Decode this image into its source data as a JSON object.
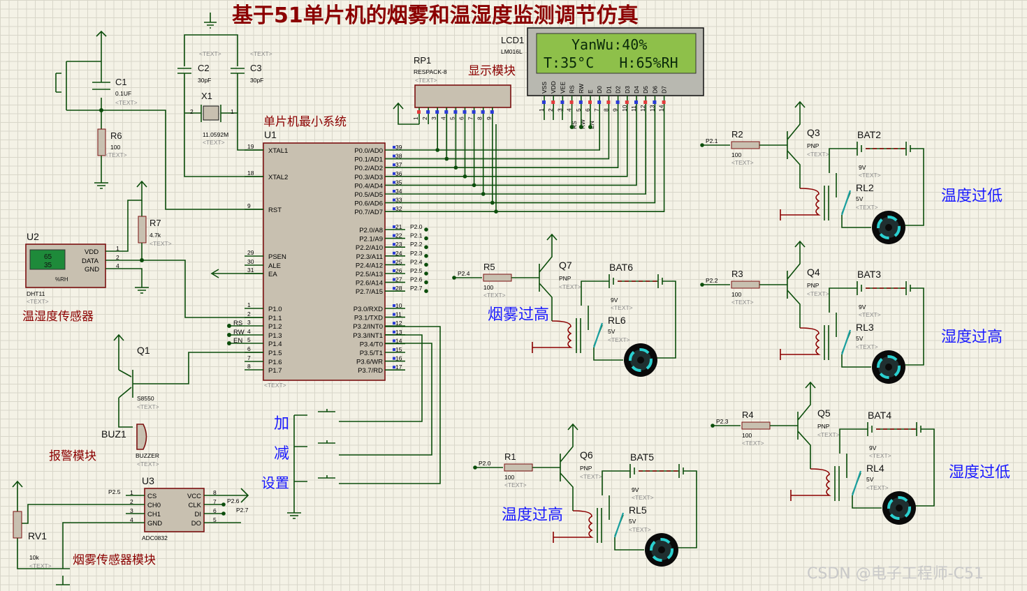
{
  "title": "基于51单片机的烟雾和温湿度监测调节仿真",
  "watermark": "CSDN @电子工程师-C51",
  "module_labels": {
    "mcu": "单片机最小系统",
    "display": "显示模块",
    "dht": "温湿度传感器",
    "alarm": "报警模块",
    "smoke_sensor": "烟雾传感器模块"
  },
  "buttons": {
    "plus": "加",
    "minus": "减",
    "set": "设置"
  },
  "actuator_labels": {
    "q3": "温度过低",
    "q4": "湿度过高",
    "q5": "湿度过低",
    "q7": "烟雾过高",
    "q6": "温度过高"
  },
  "text_placeholder": "<TEXT>",
  "lcd": {
    "ref": "LCD1",
    "model": "LM016L",
    "line1": "YanWu:40%",
    "line2": "T:35°C   H:65%RH",
    "pins": [
      "VSS",
      "VDD",
      "VEE",
      "RS",
      "RW",
      "E",
      "D0",
      "D1",
      "D2",
      "D3",
      "D4",
      "D5",
      "D6",
      "D7"
    ],
    "pin_numbers": [
      "1",
      "2",
      "3",
      "4",
      "5",
      "6",
      "7",
      "8",
      "9",
      "10",
      "11",
      "12",
      "13",
      "14"
    ],
    "net_labels": [
      "RS",
      "RW",
      "EN"
    ]
  },
  "rp1": {
    "ref": "RP1",
    "model": "RESPACK-8",
    "pins": [
      "1",
      "2",
      "3",
      "4",
      "5",
      "6",
      "7",
      "8",
      "9"
    ]
  },
  "u1": {
    "ref": "U1",
    "left_pins": [
      {
        "num": "19",
        "name": "XTAL1"
      },
      {
        "num": "18",
        "name": "XTAL2"
      },
      {
        "num": "9",
        "name": "RST"
      },
      {
        "num": "29",
        "name": "PSEN"
      },
      {
        "num": "30",
        "name": "ALE"
      },
      {
        "num": "31",
        "name": "EA"
      },
      {
        "num": "1",
        "name": "P1.0"
      },
      {
        "num": "2",
        "name": "P1.1"
      },
      {
        "num": "3",
        "name": "P1.2"
      },
      {
        "num": "4",
        "name": "P1.3"
      },
      {
        "num": "5",
        "name": "P1.4"
      },
      {
        "num": "6",
        "name": "P1.5"
      },
      {
        "num": "7",
        "name": "P1.6"
      },
      {
        "num": "8",
        "name": "P1.7"
      }
    ],
    "right_pins": [
      {
        "num": "39",
        "name": "P0.0/AD0"
      },
      {
        "num": "38",
        "name": "P0.1/AD1"
      },
      {
        "num": "37",
        "name": "P0.2/AD2"
      },
      {
        "num": "36",
        "name": "P0.3/AD3"
      },
      {
        "num": "35",
        "name": "P0.4/AD4"
      },
      {
        "num": "34",
        "name": "P0.5/AD5"
      },
      {
        "num": "33",
        "name": "P0.6/AD6"
      },
      {
        "num": "32",
        "name": "P0.7/AD7"
      },
      {
        "num": "21",
        "name": "P2.0/A8"
      },
      {
        "num": "22",
        "name": "P2.1/A9"
      },
      {
        "num": "23",
        "name": "P2.2/A10"
      },
      {
        "num": "24",
        "name": "P2.3/A11"
      },
      {
        "num": "25",
        "name": "P2.4/A12"
      },
      {
        "num": "26",
        "name": "P2.5/A13"
      },
      {
        "num": "27",
        "name": "P2.6/A14"
      },
      {
        "num": "28",
        "name": "P2.7/A15"
      },
      {
        "num": "10",
        "name": "P3.0/RXD"
      },
      {
        "num": "11",
        "name": "P3.1/TXD"
      },
      {
        "num": "12",
        "name": "P3.2/INT0"
      },
      {
        "num": "13",
        "name": "P3.3/INT1"
      },
      {
        "num": "14",
        "name": "P3.4/T0"
      },
      {
        "num": "15",
        "name": "P3.5/T1"
      },
      {
        "num": "16",
        "name": "P3.6/WR"
      },
      {
        "num": "17",
        "name": "P3.7/RD"
      }
    ],
    "p2_nets": [
      "P2.0",
      "P2.1",
      "P2.2",
      "P2.3",
      "P2.4",
      "P2.5",
      "P2.6",
      "P2.7"
    ],
    "p1_nets": [
      "RS",
      "RW",
      "EN"
    ]
  },
  "parts": {
    "c1": {
      "ref": "C1",
      "value": "0.1UF"
    },
    "c2": {
      "ref": "C2",
      "value": "30pF"
    },
    "c3": {
      "ref": "C3",
      "value": "30pF"
    },
    "x1": {
      "ref": "X1",
      "value": "11.0592M",
      "pins": [
        "2",
        "1"
      ]
    },
    "r6": {
      "ref": "R6",
      "value": "100"
    },
    "r7": {
      "ref": "R7",
      "value": "4.7k"
    },
    "u2": {
      "ref": "U2",
      "model": "DHT11",
      "temp": "65",
      "hum": "35",
      "unit": "%RH",
      "pins": [
        "VDD",
        "DATA",
        "GND"
      ],
      "pin_numbers": [
        "1",
        "2",
        "4"
      ]
    },
    "q1": {
      "ref": "Q1",
      "model": "S8550"
    },
    "buz1": {
      "ref": "BUZ1",
      "model": "BUZZER"
    },
    "u3": {
      "ref": "U3",
      "model": "ADC0832",
      "left": [
        "CS",
        "CH0",
        "CH1",
        "GND"
      ],
      "left_nums": [
        "1",
        "2",
        "3",
        "4"
      ],
      "right": [
        "VCC",
        "CLK",
        "DI",
        "DO"
      ],
      "right_nums": [
        "8",
        "7",
        "6",
        "5"
      ],
      "nets": [
        "P2.5",
        "P2.6",
        "P2.7"
      ]
    },
    "rv1": {
      "ref": "RV1",
      "value": "10k"
    },
    "r2": {
      "ref": "R2",
      "value": "100",
      "net": "P2.1"
    },
    "r3": {
      "ref": "R3",
      "value": "100",
      "net": "P2.2"
    },
    "r4": {
      "ref": "R4",
      "value": "100",
      "net": "P2.3"
    },
    "r5": {
      "ref": "R5",
      "value": "100",
      "net": "P2.4"
    },
    "r1": {
      "ref": "R1",
      "value": "100",
      "net": "P2.0"
    },
    "q3": {
      "ref": "Q3",
      "type": "PNP"
    },
    "q4": {
      "ref": "Q4",
      "type": "PNP"
    },
    "q5": {
      "ref": "Q5",
      "type": "PNP"
    },
    "q6": {
      "ref": "Q6",
      "type": "PNP"
    },
    "q7": {
      "ref": "Q7",
      "type": "PNP"
    },
    "bat2": {
      "ref": "BAT2",
      "value": "9V"
    },
    "bat3": {
      "ref": "BAT3",
      "value": "9V"
    },
    "bat4": {
      "ref": "BAT4",
      "value": "9V"
    },
    "bat5": {
      "ref": "BAT5",
      "value": "9V"
    },
    "bat6": {
      "ref": "BAT6",
      "value": "9V"
    },
    "rl2": {
      "ref": "RL2",
      "value": "5V"
    },
    "rl3": {
      "ref": "RL3",
      "value": "5V"
    },
    "rl4": {
      "ref": "RL4",
      "value": "5V"
    },
    "rl5": {
      "ref": "RL5",
      "value": "5V"
    },
    "rl6": {
      "ref": "RL6",
      "value": "5V"
    }
  }
}
